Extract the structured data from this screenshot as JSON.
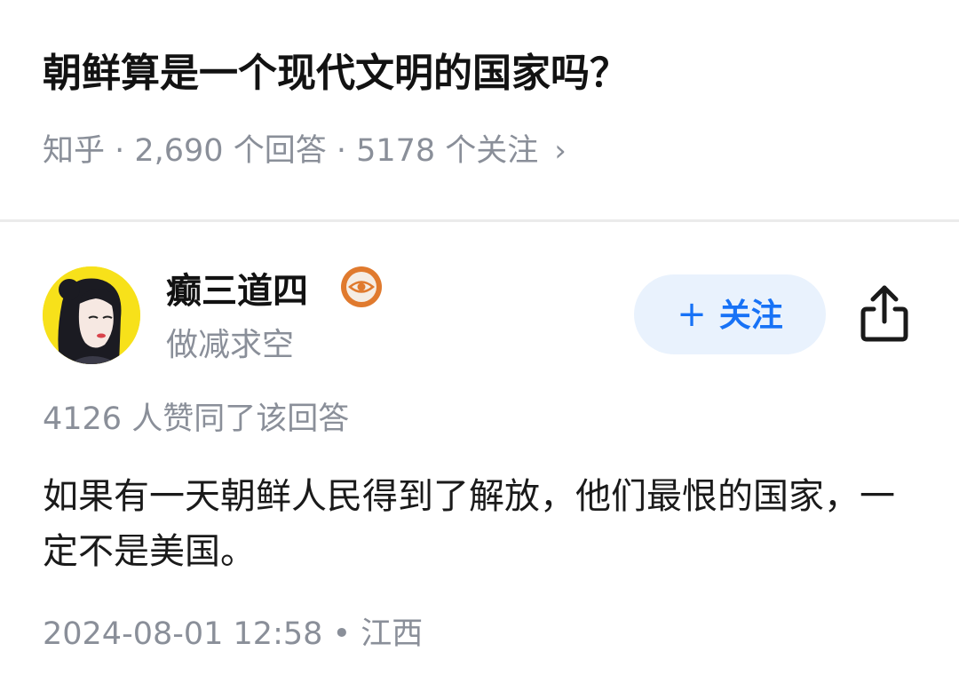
{
  "question": {
    "title": "朝鲜算是一个现代文明的国家吗？",
    "meta": "知乎 · 2,690 个回答 · 5178 个关注",
    "meta_chevron": "›"
  },
  "author": {
    "name": "癫三道四",
    "bio": "做减求空",
    "avatar_icon": "avatar-illustration",
    "badge_icon": "eye-badge-icon"
  },
  "actions": {
    "follow_plus": "+",
    "follow_label": "关注",
    "share_icon": "share-icon"
  },
  "answer": {
    "likes": "4126 人赞同了该回答",
    "content": "如果有一天朝鲜人民得到了解放，他们最恨的国家，一定不是美国。",
    "timestamp": "2024-08-01 12:58 • 江西"
  },
  "colors": {
    "accent": "#1772f6",
    "follow_bg": "#e9f2fd",
    "muted_text": "#8a8f99",
    "avatar_bg": "#f7e11a",
    "badge": "#e07a2e"
  }
}
